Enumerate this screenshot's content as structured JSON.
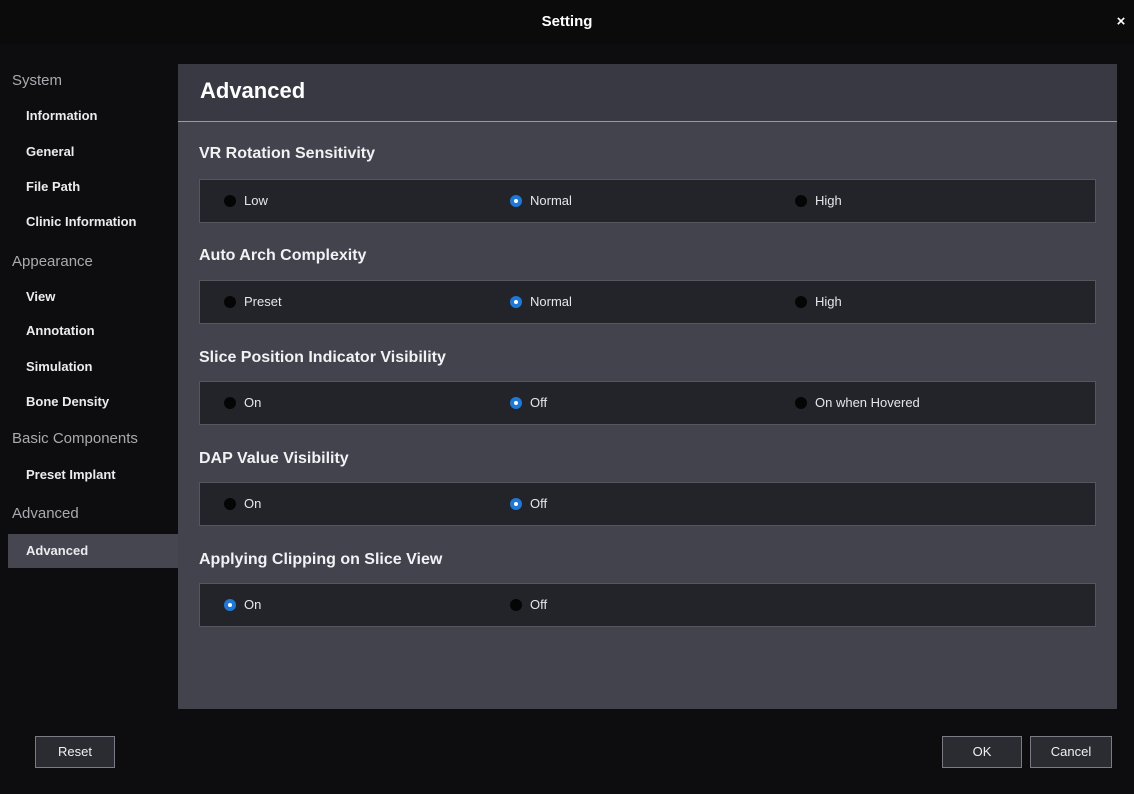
{
  "window": {
    "title": "Setting",
    "close_glyph": "×"
  },
  "sidebar": {
    "categories": [
      "System",
      "Appearance",
      "Basic Components",
      "Advanced"
    ],
    "items": [
      {
        "label": "Information",
        "category": "System"
      },
      {
        "label": "General",
        "category": "System"
      },
      {
        "label": "File Path",
        "category": "System"
      },
      {
        "label": "Clinic Information",
        "category": "System"
      },
      {
        "label": "View",
        "category": "Appearance"
      },
      {
        "label": "Annotation",
        "category": "Appearance"
      },
      {
        "label": "Simulation",
        "category": "Appearance"
      },
      {
        "label": "Bone Density",
        "category": "Appearance"
      },
      {
        "label": "Preset Implant",
        "category": "Basic Components"
      },
      {
        "label": "Advanced",
        "category": "Advanced",
        "selected": true
      }
    ]
  },
  "panel": {
    "title": "Advanced",
    "sections": [
      {
        "title": "VR Rotation Sensitivity",
        "options": [
          "Low",
          "Normal",
          "High"
        ],
        "selected": "Normal"
      },
      {
        "title": "Auto Arch Complexity",
        "options": [
          "Preset",
          "Normal",
          "High"
        ],
        "selected": "Normal"
      },
      {
        "title": "Slice Position Indicator Visibility",
        "options": [
          "On",
          "Off",
          "On when Hovered"
        ],
        "selected": "Off"
      },
      {
        "title": "DAP Value Visibility",
        "options": [
          "On",
          "Off"
        ],
        "selected": "Off"
      },
      {
        "title": "Applying Clipping on Slice View",
        "options": [
          "On",
          "Off"
        ],
        "selected": "On"
      }
    ]
  },
  "footer": {
    "reset_label": "Reset",
    "ok_label": "OK",
    "cancel_label": "Cancel"
  },
  "colors": {
    "accent": "#1f78d6",
    "panel_bg": "#42434d",
    "option_bg": "#23242a",
    "window_bg": "#0d0d0f",
    "selected_item_bg": "#45464f"
  },
  "icons": {
    "close": "close-icon",
    "radio_selected": "radio-selected-icon",
    "radio_unselected": "radio-unselected-icon"
  }
}
